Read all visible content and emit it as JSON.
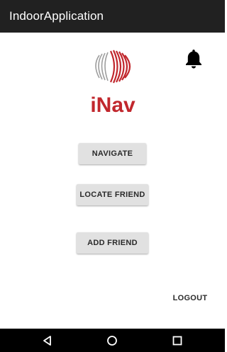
{
  "app_bar": {
    "title": "IndoorApplication"
  },
  "logo": {
    "text": "iNav",
    "brand_color": "#c1272d",
    "arc_gray": "#9e9e9e"
  },
  "notifications": {
    "icon": "bell-icon"
  },
  "buttons": {
    "navigate": "NAVIGATE",
    "locate_friend": "LOCATE FRIEND",
    "add_friend": "ADD FRIEND",
    "logout": "LOGOUT"
  },
  "system_nav": {
    "back_icon": "back-triangle-icon",
    "home_icon": "home-circle-icon",
    "recents_icon": "recents-square-icon"
  }
}
